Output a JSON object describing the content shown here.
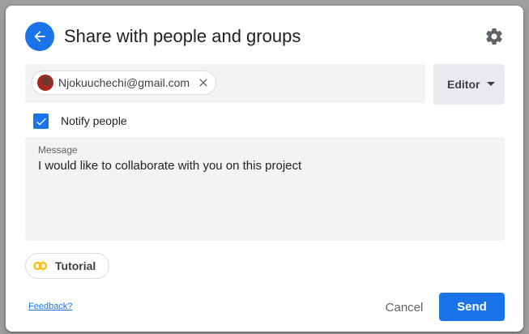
{
  "dialog": {
    "title": "Share with people and groups"
  },
  "recipients": {
    "chips": [
      {
        "email": "Njokuuchechi@gmail.com"
      }
    ]
  },
  "role": {
    "selected": "Editor"
  },
  "notify": {
    "label": "Notify people",
    "checked": true
  },
  "message": {
    "label": "Message",
    "value": "I would like to collaborate with you on this project"
  },
  "tutorial": {
    "label": "Tutorial"
  },
  "footer": {
    "feedback_label": "Feedback?",
    "cancel_label": "Cancel",
    "send_label": "Send"
  },
  "colors": {
    "accent": "#1a73e8",
    "field_bg": "#f1f3f4",
    "role_bg": "#e8eaed"
  },
  "icons": {
    "back": "arrow-left-icon",
    "settings": "gear-icon",
    "chip_close": "close-icon",
    "role_dropdown": "caret-down-icon",
    "checkbox": "check-icon",
    "tutorial": "tutorial-loop-icon"
  }
}
